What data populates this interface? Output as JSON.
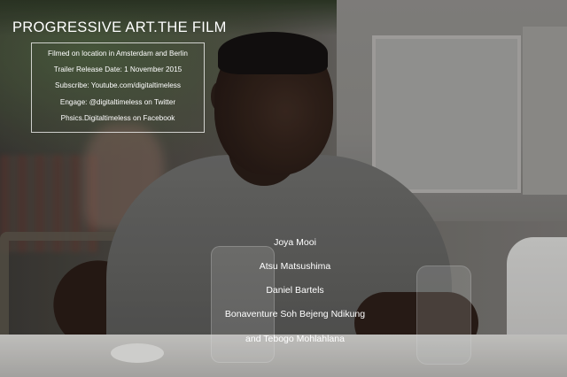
{
  "title": "PROGRESSIVE ART.THE FILM",
  "info_lines": [
    "Filmed on location in Amsterdam and Berlin",
    "Trailer Release Date: 1 November 2015",
    "Subscribe: Youtube.com/digitaltimeless",
    "Engage: @digitaltimeless on Twitter",
    "Phsics.Digitaltimeless on Facebook"
  ],
  "credits": [
    "Joya Mooi",
    "Atsu Matsushima",
    "Daniel Bartels",
    "Bonaventure Soh Bejeng Ndikung",
    "and Tebogo Mohlahlana"
  ]
}
